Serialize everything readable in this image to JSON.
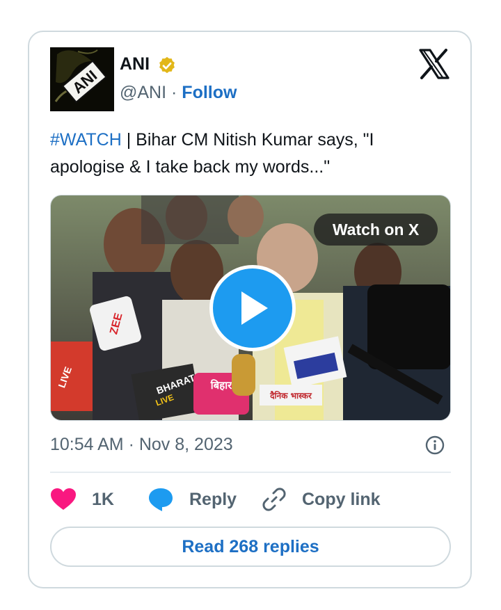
{
  "author": {
    "display_name": "ANI",
    "logo_text": "ANI",
    "handle": "@ANI",
    "separator": "·",
    "follow_label": "Follow"
  },
  "tweet": {
    "hashtag": "#WATCH",
    "text": " | Bihar CM Nitish Kumar says, \"I apologise & I take back my words...\""
  },
  "media": {
    "watch_label": "Watch on X",
    "mic_labels": [
      "ZEE",
      "LIVE",
      "BHARAT",
      "LIVE",
      "बिहार",
      "दैनिक भास्कर"
    ]
  },
  "meta": {
    "timestamp": "10:54 AM · Nov 8, 2023"
  },
  "actions": {
    "like_count": "1K",
    "reply_label": "Reply",
    "copy_label": "Copy link"
  },
  "read_replies_label": "Read 268 replies",
  "icons": [
    "verified-badge-icon",
    "x-logo-icon",
    "play-icon",
    "info-icon",
    "heart-icon",
    "reply-bubble-icon",
    "link-icon"
  ],
  "colors": {
    "link_blue": "#1d6fc4",
    "play_blue": "#1d9bf0",
    "heart_pink": "#f91880",
    "verified_gold": "#e2b719",
    "border": "#cfd9de",
    "secondary_text": "#536471"
  }
}
